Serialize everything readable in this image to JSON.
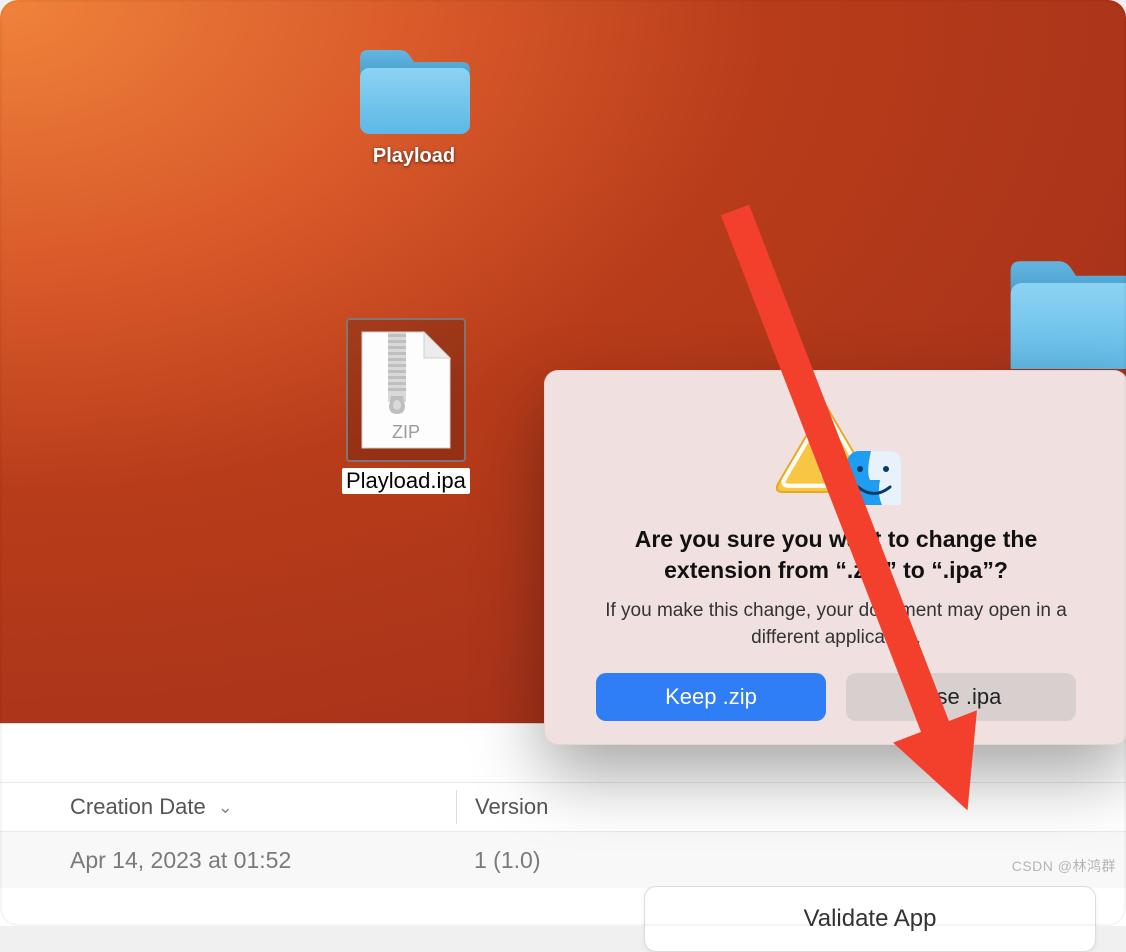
{
  "desktop": {
    "folder1_label": "Playload",
    "zip_label": "Playload.ipa",
    "zip_badge": "ZIP"
  },
  "panel": {
    "header_creation": "Creation Date",
    "header_version": "Version",
    "row_date": "Apr 14, 2023 at 01:52",
    "row_version": "1 (1.0)"
  },
  "dialog": {
    "title": "Are you sure you want to change the extension from “.zip” to “.ipa”?",
    "body": "If you make this change, your document may open in a different application.",
    "keep_label": "Keep .zip",
    "use_label": "Use .ipa"
  },
  "floating": {
    "validate_label": "Validate App"
  },
  "watermark": "CSDN @林鸿群"
}
